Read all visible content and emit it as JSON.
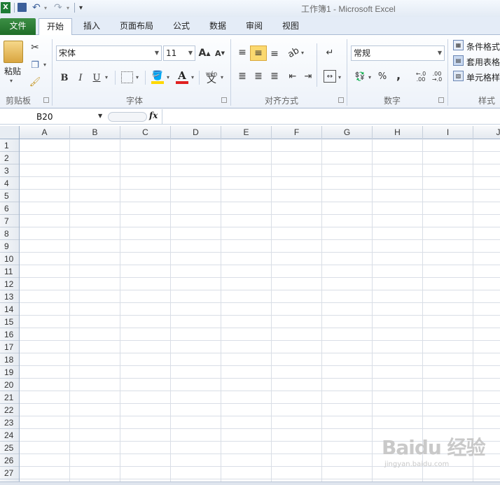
{
  "window": {
    "title": "工作簿1 - Microsoft Excel"
  },
  "quick_access": {
    "icons": [
      "excel-logo-icon",
      "save-icon",
      "undo-icon",
      "redo-icon",
      "customize-qat-icon"
    ]
  },
  "tabs": [
    {
      "label": "文件"
    },
    {
      "label": "开始"
    },
    {
      "label": "插入"
    },
    {
      "label": "页面布局"
    },
    {
      "label": "公式"
    },
    {
      "label": "数据"
    },
    {
      "label": "审阅"
    },
    {
      "label": "视图"
    }
  ],
  "ribbon": {
    "clipboard": {
      "label": "剪贴板",
      "paste_label": "粘贴"
    },
    "font": {
      "label": "字体",
      "font_name": "宋体",
      "font_size": "11",
      "bold": "B",
      "italic": "I",
      "underline": "U",
      "grow": "A",
      "shrink": "A",
      "phonetic": "wén"
    },
    "alignment": {
      "label": "对齐方式"
    },
    "number": {
      "label": "数字",
      "format": "常规",
      "percent": "%",
      "comma": ","
    },
    "styles": {
      "label": "样式",
      "items": [
        "条件格式",
        "套用表格",
        "单元格样"
      ]
    }
  },
  "formula_bar": {
    "name_box": "B20",
    "fx": "fx",
    "value": ""
  },
  "columns": [
    "A",
    "B",
    "C",
    "D",
    "E",
    "F",
    "G",
    "H",
    "I",
    "J"
  ],
  "rows": [
    "1",
    "2",
    "3",
    "4",
    "5",
    "6",
    "7",
    "8",
    "9",
    "10",
    "11",
    "12",
    "13",
    "14",
    "15",
    "16",
    "17",
    "18",
    "19",
    "20",
    "21",
    "22",
    "23",
    "24",
    "25",
    "26",
    "27"
  ],
  "watermark": {
    "text": "Baidu 经验",
    "sub": "jingyan.baidu.com"
  },
  "colors": {
    "file_tab": "#2a7d34",
    "accent": "#f0c550",
    "fill": "#ffd800",
    "font_red": "#e02020"
  }
}
